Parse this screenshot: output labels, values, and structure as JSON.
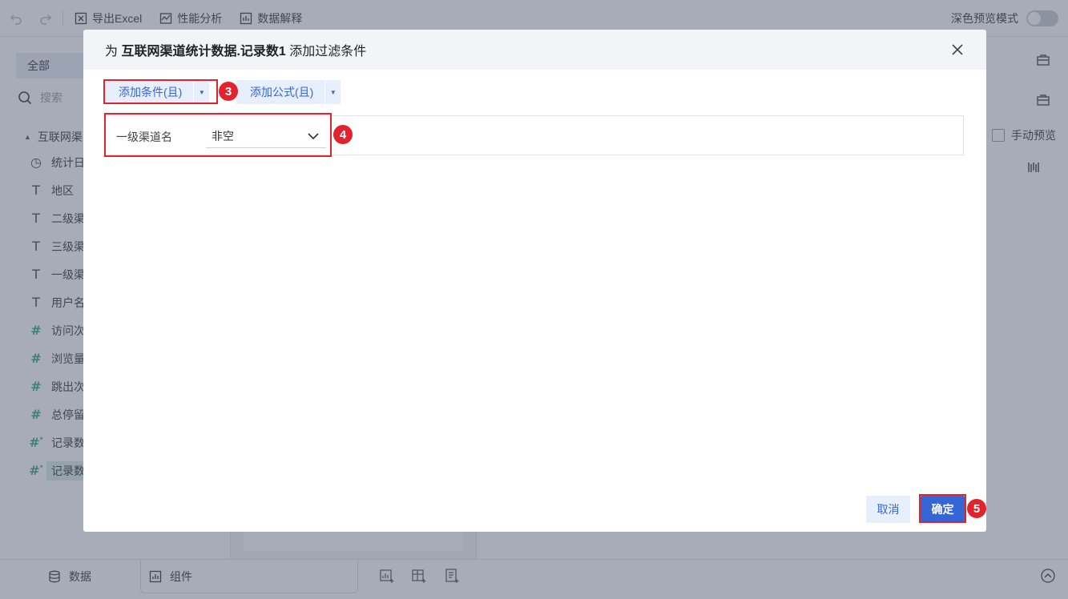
{
  "toolbar": {
    "export_excel": "导出Excel",
    "perf_analysis": "性能分析",
    "data_explain": "数据解释",
    "dark_preview": "深色预览模式"
  },
  "sidebar": {
    "tab_all": "全部",
    "search_placeholder": "搜索",
    "tree_title": "互联网渠",
    "fields": [
      {
        "label": "统计日",
        "type": "date",
        "icon": "clock-icon"
      },
      {
        "label": "地区",
        "type": "text",
        "icon": "T"
      },
      {
        "label": "二级渠",
        "type": "text",
        "icon": "T"
      },
      {
        "label": "三级渠",
        "type": "text",
        "icon": "T"
      },
      {
        "label": "一级渠",
        "type": "text",
        "icon": "T"
      },
      {
        "label": "用户名",
        "type": "text",
        "icon": "T"
      },
      {
        "label": "访问次",
        "type": "number",
        "icon": "#"
      },
      {
        "label": "浏览量",
        "type": "number",
        "icon": "#"
      },
      {
        "label": "跳出次",
        "type": "number",
        "icon": "#"
      },
      {
        "label": "总停留",
        "type": "number",
        "icon": "#"
      },
      {
        "label": "记录数",
        "type": "calc-number",
        "icon": "#*"
      },
      {
        "label": "记录数",
        "type": "calc-number",
        "icon": "#*",
        "active": true
      }
    ]
  },
  "right_panel": {
    "manual_preview": "手动预览"
  },
  "bottom": {
    "tab_data": "数据",
    "tab_component": "组件"
  },
  "dialog": {
    "title_prefix": "为",
    "title_target": "互联网渠道统计数据.记录数1",
    "title_suffix": "添加过滤条件",
    "add_condition": "添加条件(且)",
    "add_formula": "添加公式(且)",
    "condition": {
      "field": "一级渠道名",
      "operator": "非空"
    },
    "cancel": "取消",
    "confirm": "确定"
  },
  "annotations": {
    "step3": "3",
    "step4": "4",
    "step5": "5",
    "color": "#e2232e"
  },
  "colors": {
    "primary": "#3566d6",
    "primary_light": "#e7eefc",
    "number_field": "#2fa58b"
  }
}
